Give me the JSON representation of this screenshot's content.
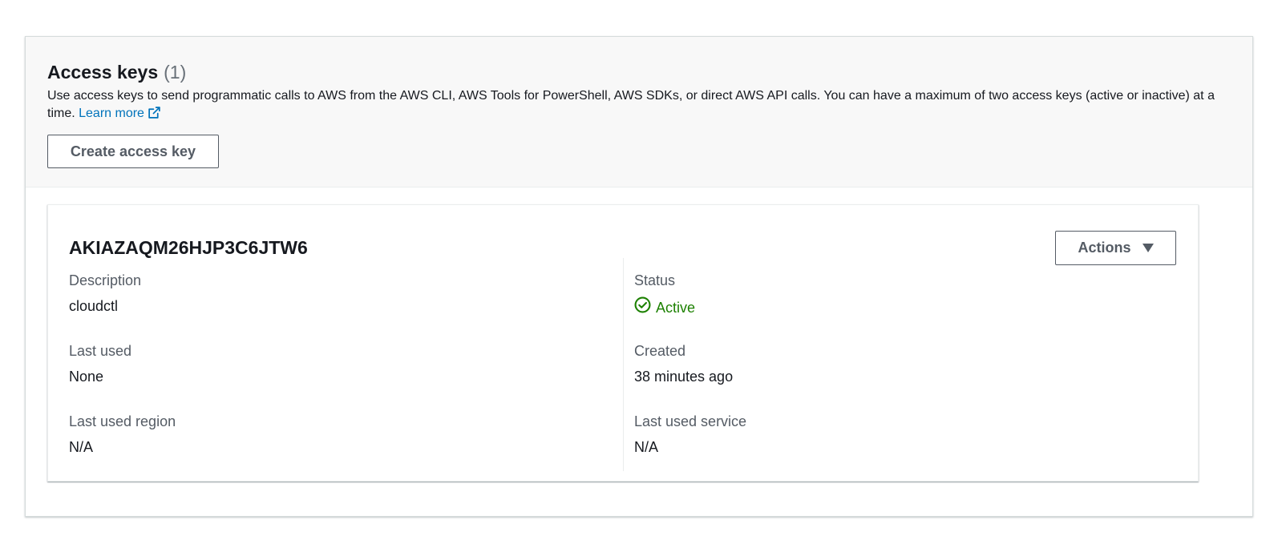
{
  "section": {
    "title": "Access keys",
    "count": "(1)",
    "description": "Use access keys to send programmatic calls to AWS from the AWS CLI, AWS Tools for PowerShell, AWS SDKs, or direct AWS API calls. You can have a maximum of two access keys (active or inactive) at a time.",
    "learn_more": "Learn more",
    "create_button": "Create access key"
  },
  "key": {
    "id": "AKIAZAQM26HJP3C6JTW6",
    "actions_button": "Actions",
    "fields": {
      "description_label": "Description",
      "description_value": "cloudctl",
      "status_label": "Status",
      "status_value": "Active",
      "last_used_label": "Last used",
      "last_used_value": "None",
      "created_label": "Created",
      "created_value": "38 minutes ago",
      "last_used_region_label": "Last used region",
      "last_used_region_value": "N/A",
      "last_used_service_label": "Last used service",
      "last_used_service_value": "N/A"
    }
  },
  "colors": {
    "link": "#0073bb",
    "status_active": "#1d8102",
    "header_bg": "#f8f8f8"
  },
  "icons": {
    "external_link": "external-link-icon",
    "status": "status-success-icon",
    "caret": "caret-down-icon"
  }
}
